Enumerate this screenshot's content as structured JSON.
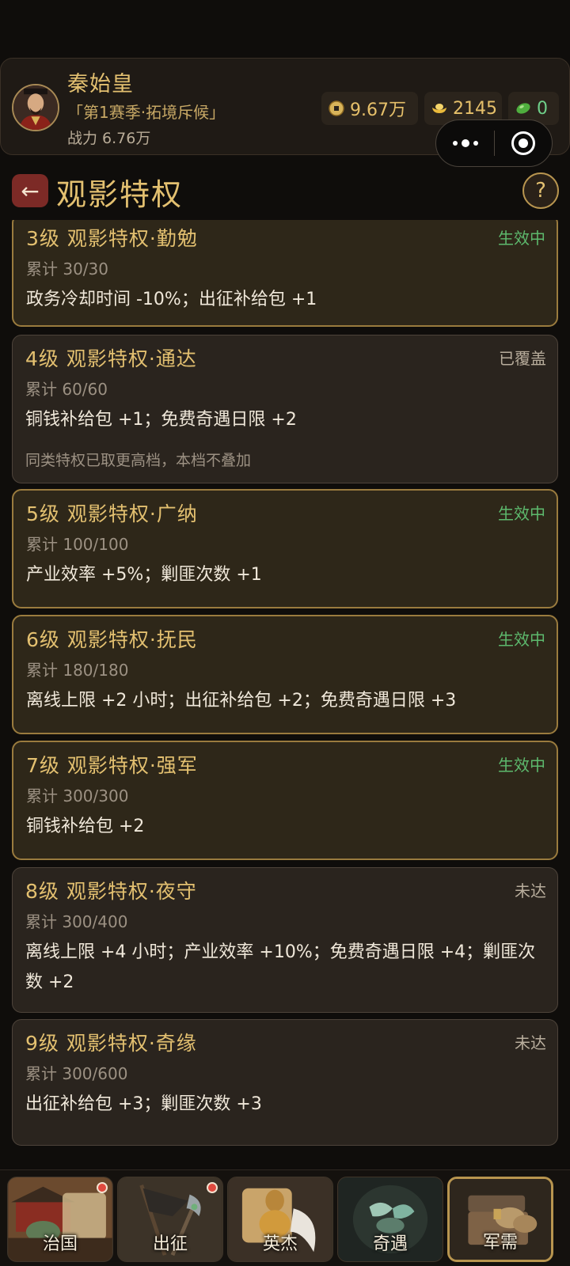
{
  "header": {
    "player_name": "秦始皇",
    "player_title": "「第1赛季·拓境斥候」",
    "power": "战力 6.76万",
    "resources": [
      {
        "icon": "copper-coin-icon",
        "value": "9.67万"
      },
      {
        "icon": "gold-ingot-icon",
        "value": "2145"
      },
      {
        "icon": "jade-icon",
        "value": "0"
      }
    ],
    "capsule": {
      "more_icon": "more-dots-icon",
      "close_icon": "close-target-icon"
    }
  },
  "title_bar": {
    "back_icon": "back-arrow-icon",
    "back_glyph": "←",
    "title": "观影特权",
    "help_glyph": "?"
  },
  "colors": {
    "gold_text": "#e3c070",
    "active_status": "#5db96d",
    "inactive_status": "#b8ad9c",
    "active_border": "#9a7b3e",
    "badge": "#e04a3f"
  },
  "privileges": [
    {
      "title": "3级 观影特权·勤勉",
      "status": "生效中",
      "active": true,
      "progress": "累计 30/30",
      "effect": "政务冷却时间 -10%；出征补给包 +1",
      "note": ""
    },
    {
      "title": "4级 观影特权·通达",
      "status": "已覆盖",
      "active": false,
      "progress": "累计 60/60",
      "effect": "铜钱补给包 +1；免费奇遇日限 +2",
      "note": "同类特权已取更高档，本档不叠加"
    },
    {
      "title": "5级 观影特权·广纳",
      "status": "生效中",
      "active": true,
      "progress": "累计 100/100",
      "effect": "产业效率 +5%；剿匪次数 +1",
      "note": ""
    },
    {
      "title": "6级 观影特权·抚民",
      "status": "生效中",
      "active": true,
      "progress": "累计 180/180",
      "effect": "离线上限 +2 小时；出征补给包 +2；免费奇遇日限 +3",
      "note": ""
    },
    {
      "title": "7级 观影特权·强军",
      "status": "生效中",
      "active": true,
      "progress": "累计 300/300",
      "effect": "铜钱补给包 +2",
      "note": ""
    },
    {
      "title": "8级 观影特权·夜守",
      "status": "未达",
      "active": false,
      "progress": "累计 300/400",
      "effect": "离线上限 +4 小时；产业效率 +10%；免费奇遇日限 +4；剿匪次数 +2",
      "note": ""
    },
    {
      "title": "9级 观影特权·奇缘",
      "status": "未达",
      "active": false,
      "progress": "累计 300/600",
      "effect": "出征补给包 +3；剿匪次数 +3",
      "note": ""
    }
  ],
  "bottom_nav": [
    {
      "label": "治国",
      "icon": "palace-icon",
      "badge": true,
      "selected": false
    },
    {
      "label": "出征",
      "icon": "war-banner-icon",
      "badge": true,
      "selected": false
    },
    {
      "label": "英杰",
      "icon": "hero-helmet-icon",
      "badge": false,
      "selected": false
    },
    {
      "label": "奇遇",
      "icon": "adventure-jade-icon",
      "badge": false,
      "selected": false
    },
    {
      "label": "军需",
      "icon": "treasure-chest-icon",
      "badge": false,
      "selected": true
    }
  ]
}
